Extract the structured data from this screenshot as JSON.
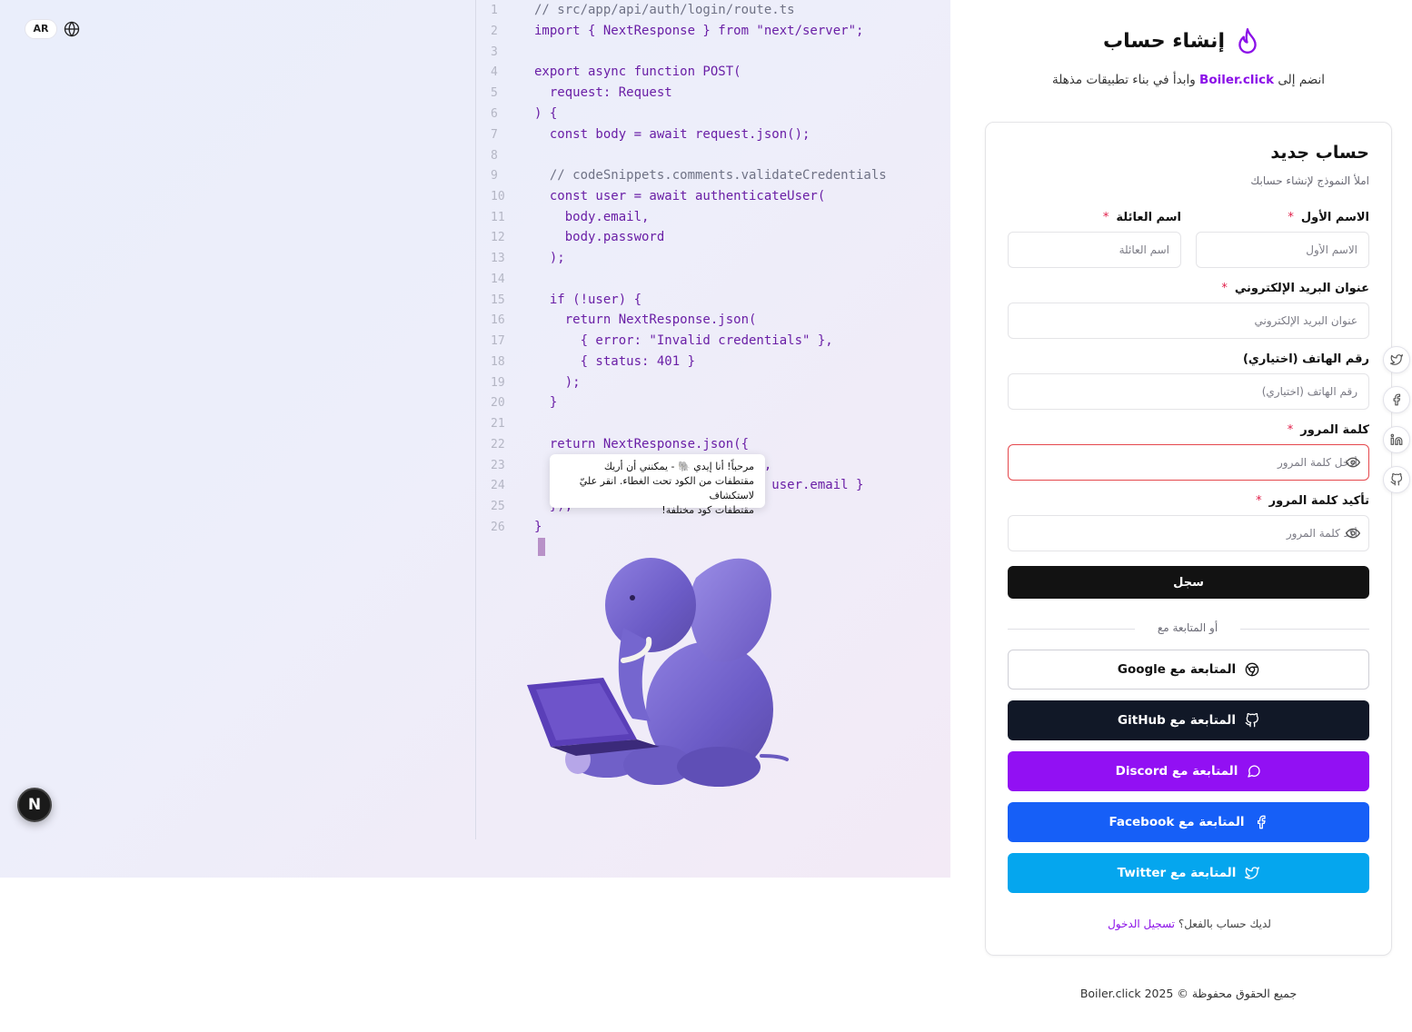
{
  "language_toggle": "AR",
  "code_editor": {
    "lines": [
      {
        "n": "1",
        "code": "// src/app/api/auth/login/route.ts",
        "comment": true
      },
      {
        "n": "2",
        "code": "import { NextResponse } from \"next/server\";"
      },
      {
        "n": "3",
        "code": ""
      },
      {
        "n": "4",
        "code": "export async function POST("
      },
      {
        "n": "5",
        "code": "  request: Request"
      },
      {
        "n": "6",
        "code": ") {"
      },
      {
        "n": "7",
        "code": "  const body = await request.json();"
      },
      {
        "n": "8",
        "code": ""
      },
      {
        "n": "9",
        "code": "  // codeSnippets.comments.validateCredentials",
        "comment": true
      },
      {
        "n": "10",
        "code": "  const user = await authenticateUser("
      },
      {
        "n": "11",
        "code": "    body.email,"
      },
      {
        "n": "12",
        "code": "    body.password"
      },
      {
        "n": "13",
        "code": "  );"
      },
      {
        "n": "14",
        "code": ""
      },
      {
        "n": "15",
        "code": "  if (!user) {"
      },
      {
        "n": "16",
        "code": "    return NextResponse.json("
      },
      {
        "n": "17",
        "code": "      { error: \"Invalid credentials\" },"
      },
      {
        "n": "18",
        "code": "      { status: 401 }"
      },
      {
        "n": "19",
        "code": "    );"
      },
      {
        "n": "20",
        "code": "  }"
      },
      {
        "n": "21",
        "code": ""
      },
      {
        "n": "22",
        "code": "  return NextResponse.json({"
      },
      {
        "n": "23",
        "code": "                             \","
      },
      {
        "n": "24",
        "code": "                             : user.email }"
      },
      {
        "n": "25",
        "code": "  });"
      },
      {
        "n": "26",
        "code": "}"
      }
    ]
  },
  "mascot_tooltip": {
    "line1": "مرحباً! أنا إيدي 🐘 - يمكنني أن أريك",
    "line2": "مقتطفات من الكود تحت الغطاء. انقر عليّ لاستكشاف",
    "line3": "مقتطفات كود مختلفة!"
  },
  "nextjs_badge": "N",
  "header": {
    "title": "إنشاء حساب",
    "subtitle_before": "انضم إلى ",
    "brand": "Boiler.click",
    "subtitle_after": " وابدأ في بناء تطبيقات مذهلة"
  },
  "form": {
    "title": "حساب جديد",
    "description": "املأ النموذج لإنشاء حسابك",
    "first_name": {
      "label": "الاسم الأول",
      "placeholder": "الاسم الأول",
      "required_mark": "*"
    },
    "last_name": {
      "label": "اسم العائلة",
      "placeholder": "اسم العائلة",
      "required_mark": "*"
    },
    "email": {
      "label": "عنوان البريد الإلكتروني",
      "placeholder": "عنوان البريد الإلكتروني",
      "required_mark": "*"
    },
    "phone": {
      "label": "رقم الهاتف (اختياري)",
      "placeholder": "رقم الهاتف (اختياري)"
    },
    "password": {
      "label": "كلمة المرور",
      "placeholder": "أدخل كلمة المرور",
      "required_mark": "*",
      "state": "error"
    },
    "confirm_password": {
      "label": "تأكيد كلمة المرور",
      "placeholder": "أكد كلمة المرور",
      "required_mark": "*"
    },
    "submit_label": "سجل",
    "divider_text": "أو المتابعة مع",
    "social": {
      "google": "المتابعة مع Google",
      "github": "المتابعة مع GitHub",
      "discord": "المتابعة مع Discord",
      "facebook": "المتابعة مع Facebook",
      "twitter": "المتابعة مع Twitter"
    },
    "signin_prompt": "لديك حساب بالفعل؟",
    "signin_link": "تسجيل الدخول"
  },
  "footer": "جميع الحقوق محفوظة © 2025 Boiler.click",
  "share_icons": [
    "twitter-icon",
    "facebook-icon",
    "linkedin-icon",
    "github-icon"
  ],
  "colors": {
    "brand_purple": "#8b10e8",
    "github": "#111827",
    "discord": "#9210f3",
    "facebook": "#165ff7",
    "twitter": "#05a6ee",
    "error": "#e5484d",
    "required": "#e11d48"
  }
}
